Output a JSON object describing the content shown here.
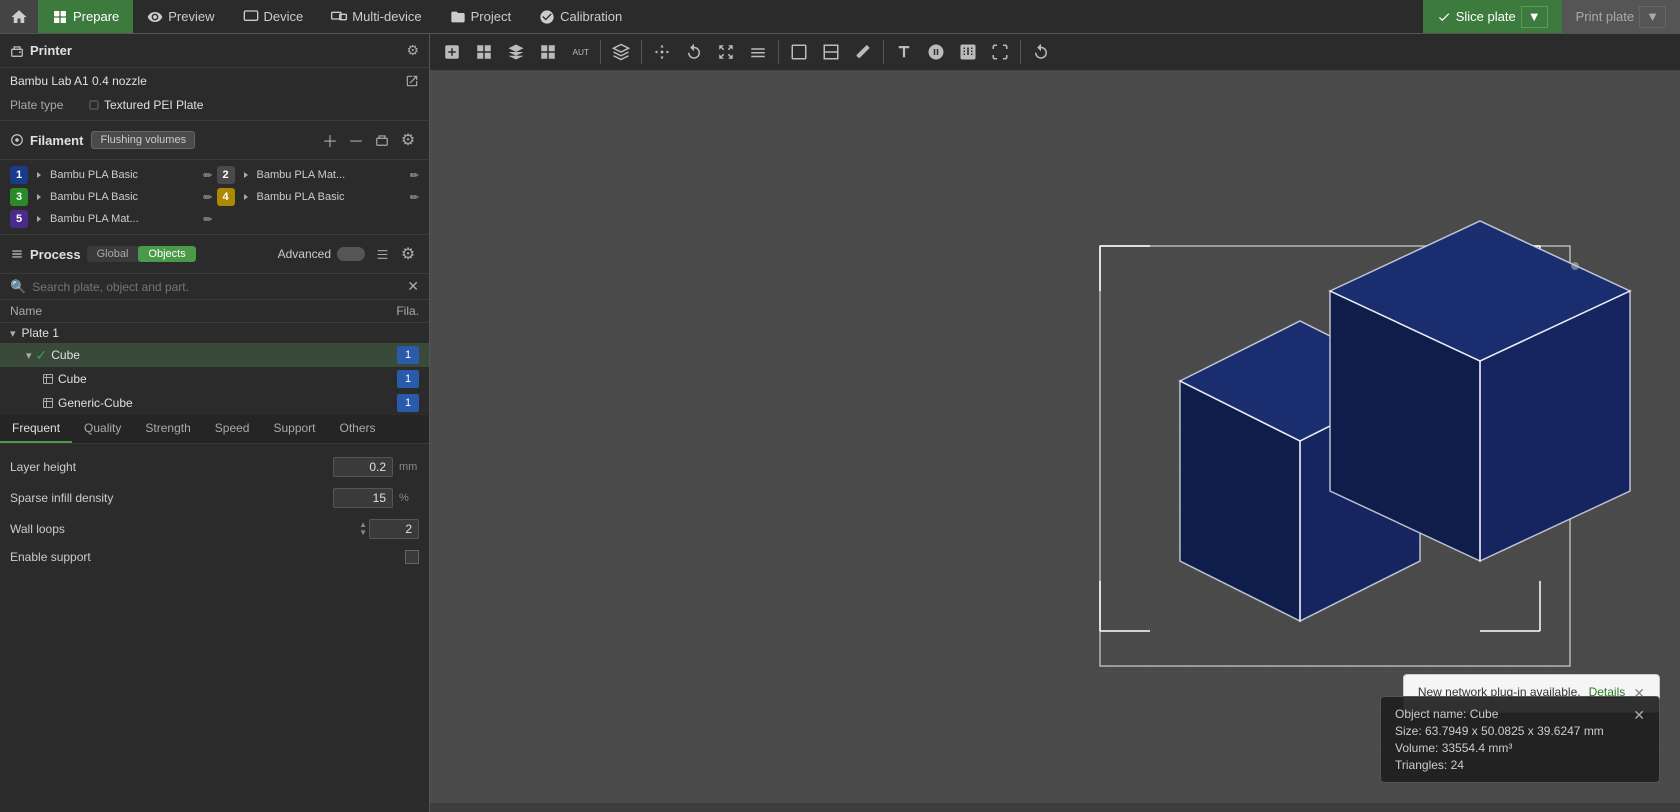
{
  "topbar": {
    "home_icon": "🏠",
    "nav_items": [
      {
        "id": "prepare",
        "label": "Prepare",
        "active": true
      },
      {
        "id": "preview",
        "label": "Preview",
        "active": false
      },
      {
        "id": "device",
        "label": "Device",
        "active": false
      },
      {
        "id": "multi-device",
        "label": "Multi-device",
        "active": false
      },
      {
        "id": "project",
        "label": "Project",
        "active": false
      },
      {
        "id": "calibration",
        "label": "Calibration",
        "active": false
      }
    ],
    "slice_label": "Slice plate",
    "print_label": "Print plate"
  },
  "printer": {
    "section_title": "Printer",
    "printer_name": "Bambu Lab A1 0.4 nozzle",
    "plate_type_label": "Plate type",
    "plate_type_value": "Textured PEI Plate"
  },
  "filament": {
    "section_title": "Filament",
    "flushing_label": "Flushing volumes",
    "items": [
      {
        "num": "1",
        "name": "Bambu PLA Basic",
        "color": "#1a3a8a"
      },
      {
        "num": "2",
        "name": "Bambu PLA Mat...",
        "color": "#4a4a4a"
      },
      {
        "num": "3",
        "name": "Bambu PLA Basic",
        "color": "#2a8a2a"
      },
      {
        "num": "4",
        "name": "Bambu PLA Basic",
        "color": "#aa8a00"
      },
      {
        "num": "5",
        "name": "Bambu PLA Mat...",
        "color": "#4a2a8a"
      }
    ]
  },
  "process": {
    "section_title": "Process",
    "toggle_global": "Global",
    "toggle_objects": "Objects",
    "advanced_label": "Advanced"
  },
  "object_tree": {
    "col_name": "Name",
    "col_fila": "Fila.",
    "plate_label": "Plate 1",
    "cube_label": "Cube",
    "cube_child1": "Cube",
    "cube_child2": "Generic-Cube"
  },
  "tabs": [
    "Frequent",
    "Quality",
    "Strength",
    "Speed",
    "Support",
    "Others"
  ],
  "settings": {
    "layer_height_label": "Layer height",
    "layer_height_value": "0.2",
    "layer_height_unit": "mm",
    "sparse_infill_label": "Sparse infill density",
    "sparse_infill_value": "15",
    "sparse_infill_unit": "%",
    "wall_loops_label": "Wall loops",
    "wall_loops_value": "2",
    "enable_support_label": "Enable support"
  },
  "notification": {
    "message": "New network plug-in available.",
    "link_text": "Details"
  },
  "obj_info": {
    "name_label": "Object name: Cube",
    "size_label": "Size: 63.7949 x 50.0825 x 39.6247 mm",
    "volume_label": "Volume: 33554.4 mm³",
    "triangles_label": "Triangles: 24"
  },
  "search": {
    "placeholder": "Search plate, object and part."
  }
}
